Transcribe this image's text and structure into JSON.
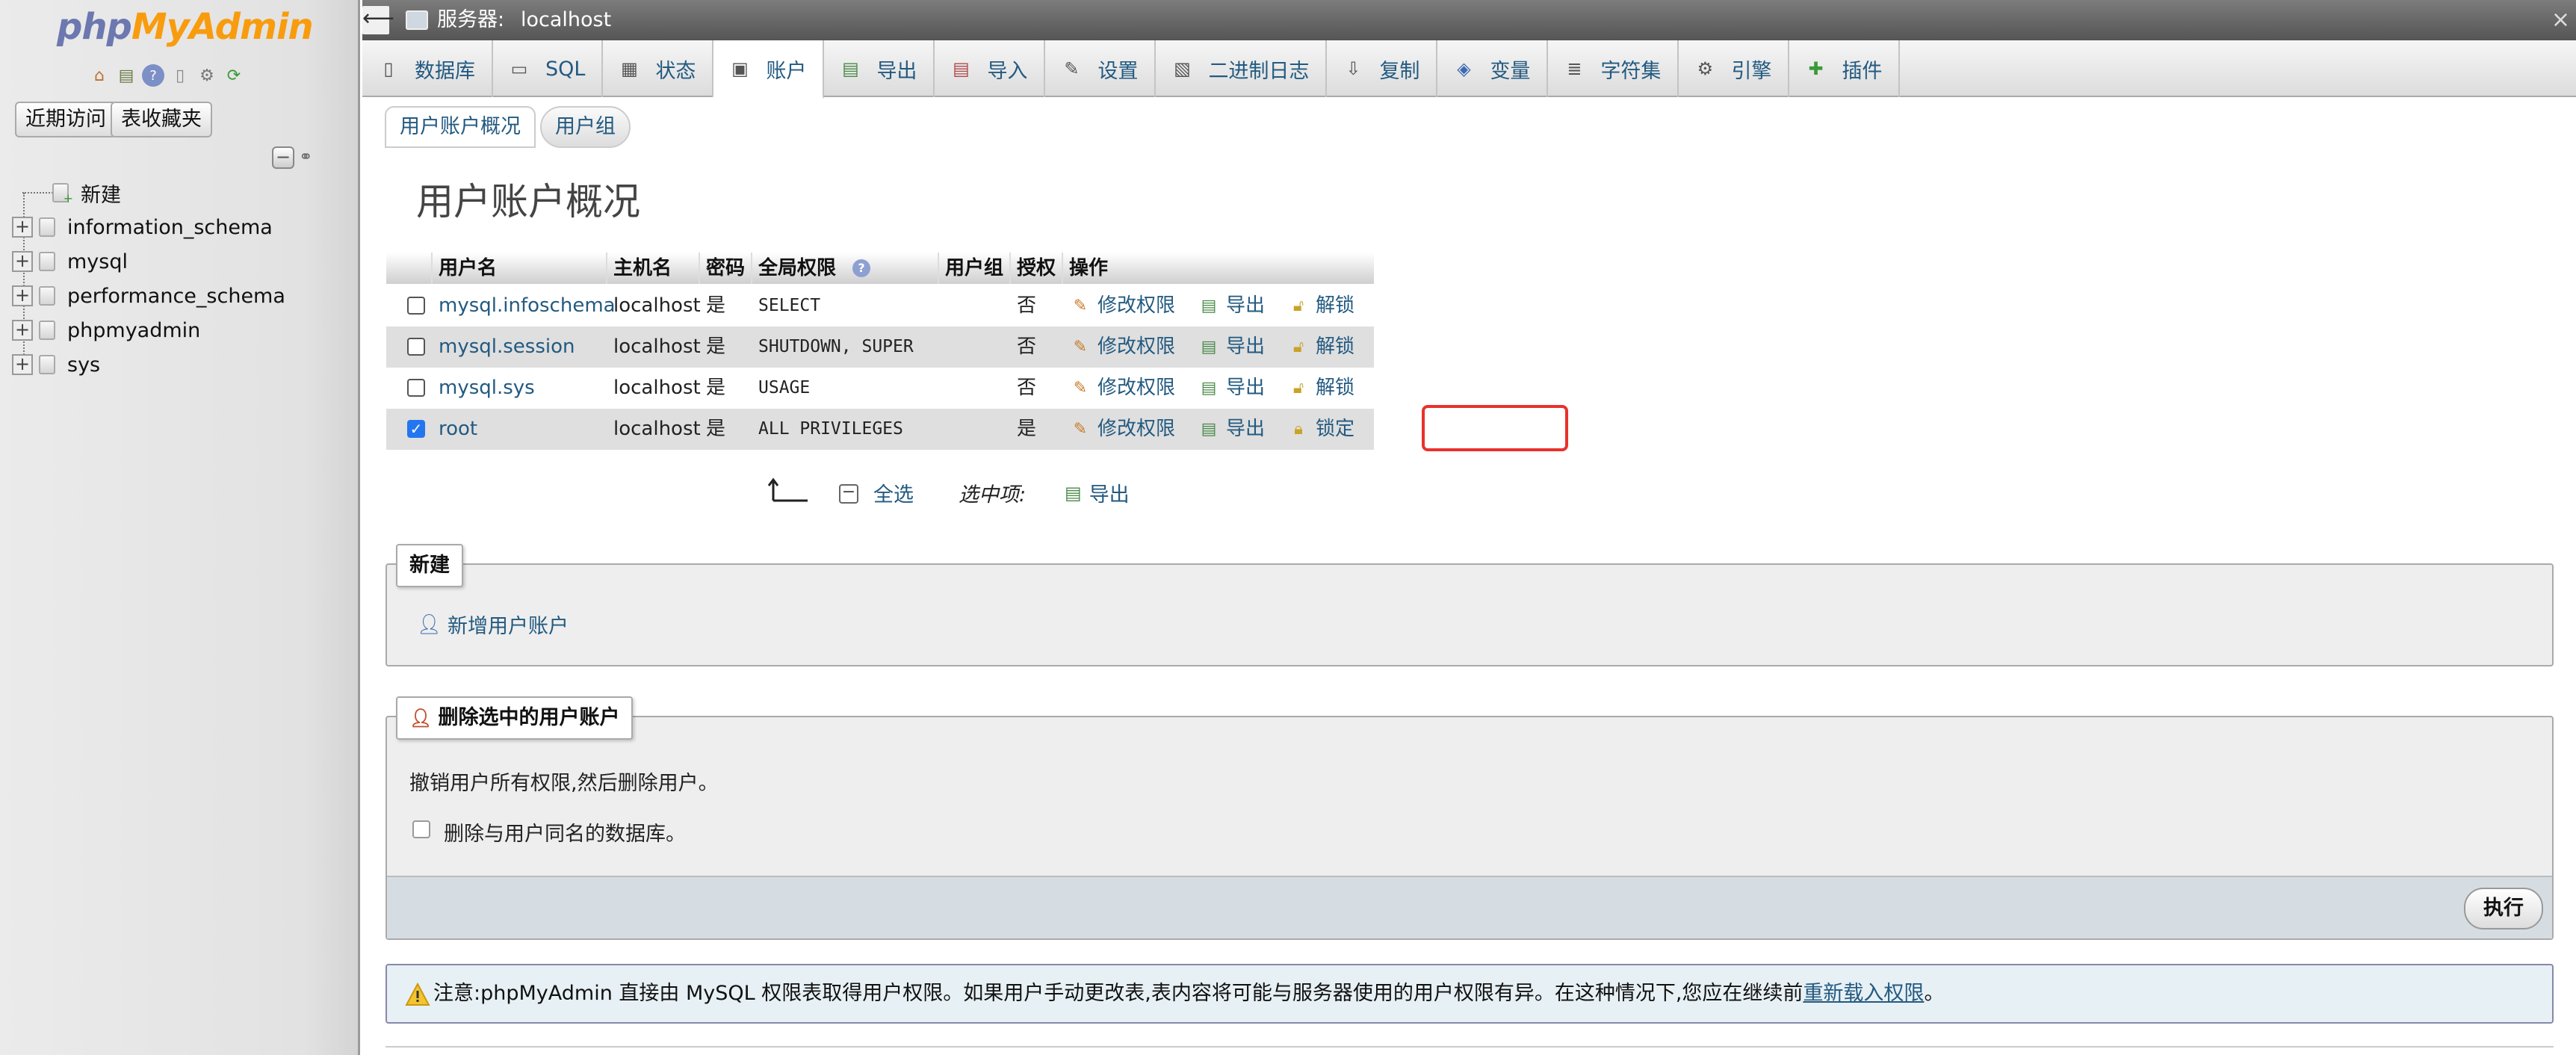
{
  "nav": {
    "logo_php": "php",
    "logo_myadmin": "MyAdmin",
    "icons": [
      "home-icon",
      "logout-icon",
      "help-icon",
      "docs-icon",
      "settings-icon",
      "reload-icon"
    ],
    "recent_label": "近期访问",
    "favorites_label": "表收藏夹",
    "tree": [
      {
        "label": "新建",
        "expandable": false
      },
      {
        "label": "information_schema",
        "expandable": true
      },
      {
        "label": "mysql",
        "expandable": true
      },
      {
        "label": "performance_schema",
        "expandable": true
      },
      {
        "label": "phpmyadmin",
        "expandable": true
      },
      {
        "label": "sys",
        "expandable": true
      }
    ]
  },
  "titlebar": {
    "server_label": "服务器:",
    "server_name": "localhost"
  },
  "tabs": [
    {
      "label": "数据库",
      "icon": "database-icon"
    },
    {
      "label": "SQL",
      "icon": "sql-icon"
    },
    {
      "label": "状态",
      "icon": "status-icon"
    },
    {
      "label": "账户",
      "icon": "accounts-icon",
      "active": true
    },
    {
      "label": "导出",
      "icon": "export-icon"
    },
    {
      "label": "导入",
      "icon": "import-icon"
    },
    {
      "label": "设置",
      "icon": "wrench-icon"
    },
    {
      "label": "二进制日志",
      "icon": "binlog-icon"
    },
    {
      "label": "复制",
      "icon": "replication-icon"
    },
    {
      "label": "变量",
      "icon": "variables-icon"
    },
    {
      "label": "字符集",
      "icon": "charset-icon"
    },
    {
      "label": "引擎",
      "icon": "engine-icon"
    },
    {
      "label": "插件",
      "icon": "plugin-icon"
    }
  ],
  "subtabs": {
    "overview": "用户账户概况",
    "groups": "用户组"
  },
  "page_title": "用户账户概况",
  "table": {
    "headers": {
      "username": "用户名",
      "host": "主机名",
      "password": "密码",
      "global_privs": "全局权限",
      "group": "用户组",
      "grant": "授权",
      "actions": "操作"
    },
    "rows": [
      {
        "checked": false,
        "user": "mysql.infoschema",
        "host": "localhost",
        "password": "是",
        "privs": "SELECT",
        "group": "",
        "grant": "否",
        "edit": "修改权限",
        "export": "导出",
        "lock": "解锁"
      },
      {
        "checked": false,
        "user": "mysql.session",
        "host": "localhost",
        "password": "是",
        "privs": "SHUTDOWN, SUPER",
        "group": "",
        "grant": "否",
        "edit": "修改权限",
        "export": "导出",
        "lock": "解锁"
      },
      {
        "checked": false,
        "user": "mysql.sys",
        "host": "localhost",
        "password": "是",
        "privs": "USAGE",
        "group": "",
        "grant": "否",
        "edit": "修改权限",
        "export": "导出",
        "lock": "解锁"
      },
      {
        "checked": true,
        "user": "root",
        "host": "localhost",
        "password": "是",
        "privs": "ALL PRIVILEGES",
        "group": "",
        "grant": "是",
        "edit": "修改权限",
        "export": "导出",
        "lock": "锁定"
      }
    ]
  },
  "footer": {
    "select_all": "全选",
    "with_selected": "选中项:",
    "export": "导出"
  },
  "new_section": {
    "legend": "新建",
    "add_user": "新增用户账户"
  },
  "delete_section": {
    "legend": "删除选中的用户账户",
    "description": "撤销用户所有权限,然后删除用户。",
    "drop_db_label": "删除与用户同名的数据库。",
    "go": "执行"
  },
  "notice": {
    "text": "注意:phpMyAdmin 直接由 MySQL 权限表取得用户权限。如果用户手动更改表,表内容将可能与服务器使用的用户权限有异。在这种情况下,您应在继续前",
    "link": "重新载入权限",
    "suffix": "。"
  },
  "colors": {
    "link": "#235a81",
    "highlight": "#e8322c",
    "checkbox": "#2476f0"
  }
}
